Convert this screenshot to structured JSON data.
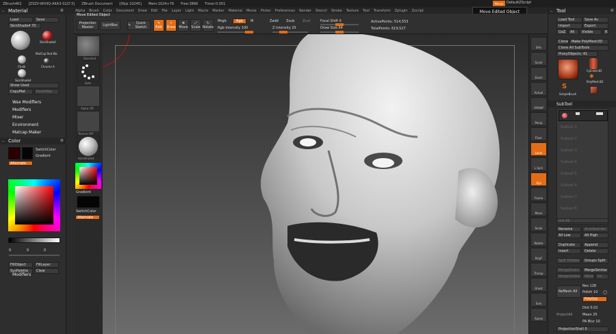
{
  "app": {
    "title_items": [
      "ZBrush4R2",
      "[ZSZV-WH3Q-AKA3-S1LT-3]",
      "ZBrush Document",
      "[Objs 10245]",
      "Mem:1024+76",
      "Free:3866",
      "Timer:0.001"
    ],
    "quick_save": "Menus",
    "script": "DefaultZScript"
  },
  "menus": [
    "Alpha",
    "Brush",
    "Color",
    "Document",
    "Draw",
    "Edit",
    "File",
    "Layer",
    "Light",
    "Macro",
    "Marker",
    "Material",
    "Movie",
    "Picker",
    "Preferences",
    "Render",
    "Stencil",
    "Stroke",
    "Texture",
    "Tool",
    "Transform",
    "Zplugin",
    "Zscript"
  ],
  "popup": "Move Edited Object",
  "toolbar": {
    "hint": "Move Edited Object",
    "projection_master": "Projection Master",
    "lightbox": "LightBox",
    "quick_sketch": "Quick Sketch",
    "edit": "Edit",
    "draw": "Draw",
    "move": "Move",
    "scale": "Scale",
    "rotate": "Rotate",
    "mrgb": "Mrgb",
    "rgb": "Rgb",
    "m": "M",
    "rgb_intensity": "Rgb Intensity 100",
    "zadd": "Zadd",
    "zsub": "Zsub",
    "zcut": "Zcut",
    "z_intensity": "Z Intensity 25",
    "focal_shift": "Focal Shift 0",
    "draw_size": "Draw Size 64",
    "active_points": "ActivePoints: 514,553",
    "total_points": "TotalPoints: 619,527",
    "rgb_intensity_level": 1.0,
    "z_intensity_level": 0.25,
    "focal_shift_level": 0.5,
    "draw_size_level": 0.5
  },
  "left": {
    "material_title": "Material",
    "load": "Load",
    "save": "Save",
    "skinshade": "SkinShade4  70",
    "mat_labels": [
      "SkinShade4",
      "MatCap Red Wa",
      "Chalk",
      "Chrome A",
      "SkinShade4"
    ],
    "show_used": "Show Used",
    "copymat": "CopyMat",
    "pastemat": "PasteMat",
    "sections": [
      "Wax Modifiers",
      "Modifiers",
      "Mixer",
      "Environment",
      "Matcap Maker"
    ],
    "color_title": "Color",
    "switchcolor": "SwitchColor",
    "gradient": "Gradient",
    "alternate": "Alternate",
    "rgb_values": [
      "0",
      "0",
      "0"
    ],
    "fillobject": "FillObject",
    "filllayer": "FillLayer",
    "syspalette": "SysPalette",
    "clear": "Clear",
    "modifiers": "Modifiers"
  },
  "brushcol": {
    "labels": [
      "Standard",
      "Dots",
      "Alpha Off",
      "Texture Off",
      "SkinShade4"
    ],
    "gradient": "Gradient",
    "switchcolor": "SwitchColor",
    "alternate": "Alternate"
  },
  "rshelf": [
    "SPix",
    "Scroll",
    "Zoom",
    "Actual",
    "AAHalf",
    "Persp",
    "Floor",
    "Local",
    "L.Sym",
    "Xyz",
    "Frame",
    "Move",
    "Scale",
    "Rotate",
    "PolyF",
    "Transp",
    "Ghost",
    "Solo",
    "Xpose"
  ],
  "tool": {
    "title": "Tool",
    "load_tool": "Load Tool",
    "save_as": "Save As",
    "import": "Import",
    "export": "Export",
    "goz": "GoZ",
    "all": "All",
    "visible": "Visible",
    "r": "R",
    "clone": "Clone",
    "make_polymesh": "Make PolyMesh3D",
    "clone_all": "Clone All SubTools",
    "proxy": "ProxyObjects: 41",
    "tool_labels": [
      "Cylinder3D",
      "PolyMesh3D",
      "SimpleBrush",
      "Cube3D"
    ],
    "subtool": "SubTool",
    "subtool_slots": [
      "Subtool 1",
      "Subtool 2",
      "Subtool 3",
      "Subtool 4",
      "Subtool 5",
      "Subtool 6",
      "Subtool 7",
      "Subtool 8"
    ],
    "list_all": "List All",
    "rename": "Rename",
    "autoreorder": "AutoReorder",
    "all_low": "All Low",
    "all_high": "All High",
    "duplicate": "Duplicate",
    "append": "Append",
    "insert": "Insert",
    "delete": "Delete",
    "split_hidden": "Split Hidden",
    "groups_split": "Groups Split",
    "merge_down": "MergeDown",
    "merge_similar": "MergeSimilar",
    "merge_visible": "MergeVisible",
    "weld": "Weld",
    "uv": "Uv",
    "remesh_all": "ReMesh All",
    "res": "Res 128",
    "polish": "Polish 10",
    "polygrp": "PolyGrp",
    "project_all": "ProjectAll",
    "dist": "Dist 0.02",
    "mean": "Mean 25",
    "pa_blur": "PA Blur 10",
    "projection_shell": "ProjectionShell 0"
  }
}
